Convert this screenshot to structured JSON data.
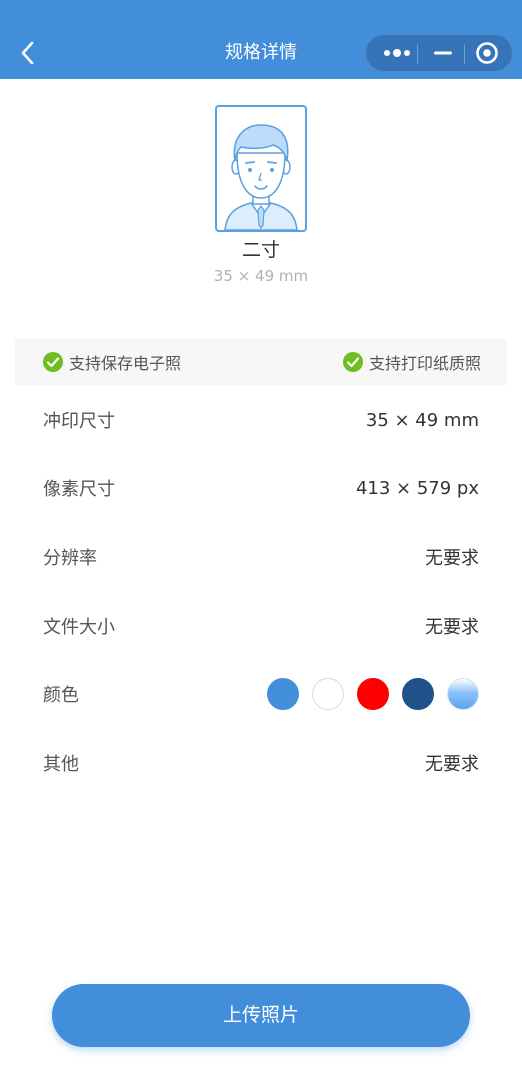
{
  "header": {
    "title": "规格详情",
    "back_icon": "chevron-left-icon",
    "capsule_icons": [
      "more-dots-icon",
      "minimize-icon",
      "close-circle-icon"
    ],
    "color": "#428edb"
  },
  "spec": {
    "name": "二寸",
    "dimension": "35 × 49 mm",
    "illustration": "id-photo-avatar-icon"
  },
  "support": {
    "left_label": "支持保存电子照",
    "right_label": "支持打印纸质照",
    "check_color": "#6cbf1e"
  },
  "details": {
    "print_size": {
      "label": "冲印尺寸",
      "value": "35 × 49 mm"
    },
    "pixel_size": {
      "label": "像素尺寸",
      "value": "413 × 579 px"
    },
    "resolution": {
      "label": "分辨率",
      "value": "无要求"
    },
    "file_size": {
      "label": "文件大小",
      "value": "无要求"
    },
    "color": {
      "label": "颜色",
      "swatches": [
        "#438fdc",
        "#ffffff",
        "#ff0000",
        "#1f5289",
        "#8ec2f8"
      ]
    },
    "other": {
      "label": "其他",
      "value": "无要求"
    }
  },
  "upload_button": {
    "label": "上传照片"
  }
}
